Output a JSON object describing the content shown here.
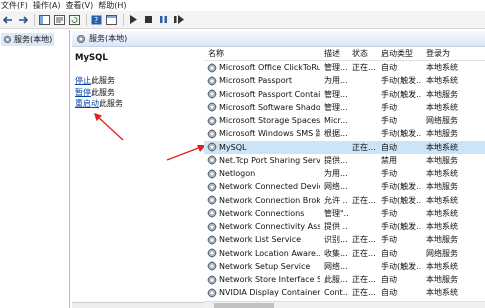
{
  "menu": [
    "文件(F)",
    "操作(A)",
    "查看(V)",
    "帮助(H)"
  ],
  "tree": {
    "label": "服务(本地)"
  },
  "header": {
    "title": "服务(本地)"
  },
  "desc": {
    "service_name": "MySQL",
    "links": [
      {
        "link": "停止",
        "rest": "此服务"
      },
      {
        "link": "暂停",
        "rest": "此服务"
      },
      {
        "link": "重启动",
        "rest": "此服务"
      }
    ]
  },
  "columns": [
    "名称",
    "描述",
    "状态",
    "启动类型",
    "登录为"
  ],
  "rows": [
    [
      "Microsoft Office ClickToRun...",
      "管理...",
      "正在...",
      "自动",
      "本地系统"
    ],
    [
      "Microsoft Passport",
      "为用...",
      "",
      "手动(触发...",
      "本地系统"
    ],
    [
      "Microsoft Passport Container",
      "管理...",
      "",
      "手动(触发...",
      "本地服务"
    ],
    [
      "Microsoft Software Shado...",
      "管理...",
      "",
      "手动",
      "本地系统"
    ],
    [
      "Microsoft Storage Spaces S...",
      "Micr...",
      "",
      "手动",
      "网络服务"
    ],
    [
      "Microsoft Windows SMS 路...",
      "根据...",
      "",
      "手动(触发...",
      "本地服务"
    ],
    [
      "MySQL",
      "",
      "正在...",
      "自动",
      "本地系统"
    ],
    [
      "Net.Tcp Port Sharing Service",
      "提供...",
      "",
      "禁用",
      "本地服务"
    ],
    [
      "Netlogon",
      "为用...",
      "",
      "手动",
      "本地系统"
    ],
    [
      "Network Connected Devic...",
      "网络...",
      "",
      "手动(触发...",
      "本地服务"
    ],
    [
      "Network Connection Broker",
      "允许 ...",
      "正在...",
      "手动(触发...",
      "本地系统"
    ],
    [
      "Network Connections",
      "管理\"...",
      "",
      "手动",
      "本地系统"
    ],
    [
      "Network Connectivity Assis...",
      "提供 ...",
      "",
      "手动(触发...",
      "本地系统"
    ],
    [
      "Network List Service",
      "识别...",
      "正在...",
      "手动",
      "本地服务"
    ],
    [
      "Network Location Aware...",
      "收集...",
      "正在...",
      "自动",
      "网络服务"
    ],
    [
      "Network Setup Service",
      "网络...",
      "",
      "手动(触发...",
      "本地系统"
    ],
    [
      "Network Store Interface Se...",
      "此服...",
      "正在...",
      "自动",
      "本地服务"
    ],
    [
      "NVIDIA Display Container LS",
      "Cont...",
      "正在...",
      "自动",
      "本地系统"
    ]
  ],
  "selected_index": 6,
  "colors": {
    "arrow": "#e02020",
    "selection": "#cce4f7",
    "link": "#0645ad"
  }
}
